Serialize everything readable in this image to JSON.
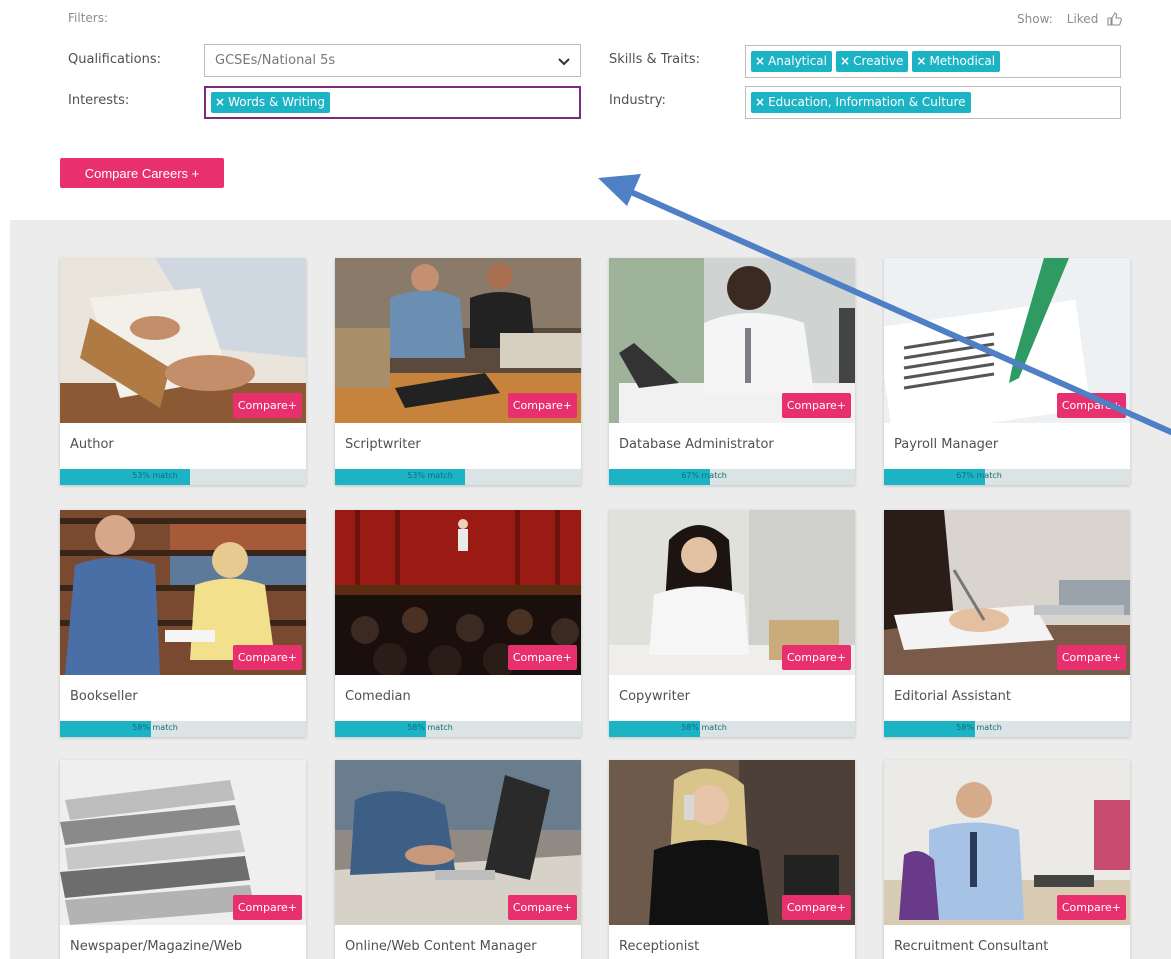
{
  "filters": {
    "title": "Filters:",
    "show_label": "Show:",
    "liked_label": "Liked",
    "qualifications": {
      "label": "Qualifications:",
      "value": "GCSEs/National 5s"
    },
    "interests": {
      "label": "Interests:",
      "tags": [
        "Words & Writing"
      ]
    },
    "skills": {
      "label": "Skills & Traits:",
      "tags": [
        "Analytical",
        "Creative",
        "Methodical"
      ]
    },
    "industry": {
      "label": "Industry:",
      "tags": [
        "Education, Information & Culture"
      ]
    }
  },
  "compare_careers_label": "Compare Careers +",
  "card_compare_label": "Compare+",
  "colors": {
    "accent_pink": "#e8306f",
    "tag_teal": "#1cb4c4",
    "focus_purple": "#7a2b7e",
    "grid_bg": "#ececec",
    "arrow_blue": "#4f7fc4"
  },
  "careers": [
    {
      "title": "Author",
      "match_text": "53% match",
      "match": 0.53,
      "image": "person-reading-book"
    },
    {
      "title": "Scriptwriter",
      "match_text": "53% match",
      "match": 0.53,
      "image": "men-writing-with-books"
    },
    {
      "title": "Database Administrator",
      "match_text": "67% match",
      "match": 0.41,
      "image": "man-at-laptop"
    },
    {
      "title": "Payroll Manager",
      "match_text": "67% match",
      "match": 0.41,
      "image": "pen-on-payroll-sheet"
    },
    {
      "title": "Bookseller",
      "match_text": "58% match",
      "match": 0.37,
      "image": "people-in-bookshop"
    },
    {
      "title": "Comedian",
      "match_text": "58% match",
      "match": 0.37,
      "image": "comedian-on-stage"
    },
    {
      "title": "Copywriter",
      "match_text": "58% match",
      "match": 0.37,
      "image": "woman-at-laptop"
    },
    {
      "title": "Editorial Assistant",
      "match_text": "58% match",
      "match": 0.37,
      "image": "hand-writing-at-desk"
    },
    {
      "title": "Newspaper/Magazine/Web",
      "match_text": "",
      "match": 0,
      "image": "stack-of-newspapers"
    },
    {
      "title": "Online/Web Content Manager",
      "match_text": "",
      "match": 0,
      "image": "people-at-laptop"
    },
    {
      "title": "Receptionist",
      "match_text": "",
      "match": 0,
      "image": "receptionist-on-phone"
    },
    {
      "title": "Recruitment Consultant",
      "match_text": "",
      "match": 0,
      "image": "man-on-phone-at-desk"
    }
  ]
}
